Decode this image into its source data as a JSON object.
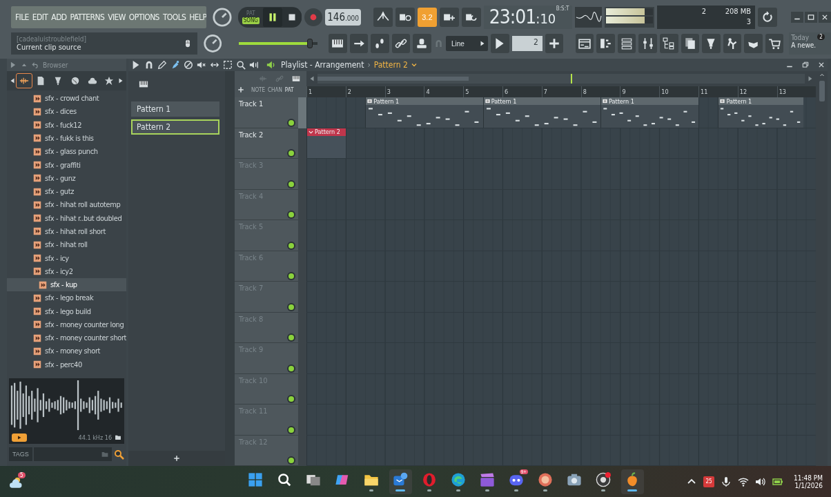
{
  "menu": [
    "FILE",
    "EDIT",
    "ADD",
    "PATTERNS",
    "VIEW",
    "OPTIONS",
    "TOOLS",
    "HELP"
  ],
  "hint": {
    "title": "[cadealuistroublefield]",
    "text": "Current clip source"
  },
  "transport": {
    "modes": [
      {
        "label": "PAT",
        "selected": false
      },
      {
        "label": "SONG",
        "selected": true
      }
    ],
    "playing": true
  },
  "master_volume": {
    "level": 0.9
  },
  "tempo": {
    "whole": "146",
    "fraction": ".000"
  },
  "snap_toggle": {
    "label": "3.2",
    "on": true
  },
  "time": {
    "main": "23:01",
    "sub": ":10",
    "unit": "B:S:T"
  },
  "cpu": {
    "polyphony": "2",
    "memory": "208 MB",
    "cores": "3"
  },
  "snap": {
    "value": "Line"
  },
  "pattern_selector": {
    "value": "2"
  },
  "news": {
    "title": "Today",
    "text": "A newe.",
    "badge": "2"
  },
  "browser": {
    "title": "Browser",
    "tabs": [
      {
        "kind": "waveform",
        "selected": true
      },
      {
        "kind": "file",
        "selected": false
      },
      {
        "kind": "plug",
        "selected": false
      },
      {
        "kind": "globe",
        "selected": false
      },
      {
        "kind": "cloud",
        "selected": false
      },
      {
        "kind": "star",
        "selected": false
      }
    ],
    "items": [
      {
        "label": "sfx - crowd chant",
        "selected": false
      },
      {
        "label": "sfx - dices",
        "selected": false
      },
      {
        "label": "sfx - fuck12",
        "selected": false
      },
      {
        "label": "sfx - fukk is this",
        "selected": false
      },
      {
        "label": "sfx - glass punch",
        "selected": false
      },
      {
        "label": "sfx - graffiti",
        "selected": false
      },
      {
        "label": "sfx - gunz",
        "selected": false
      },
      {
        "label": "sfx - gutz",
        "selected": false
      },
      {
        "label": "sfx - hihat roll autotemp",
        "selected": false
      },
      {
        "label": "sfx - hihat r..but doubled",
        "selected": false
      },
      {
        "label": "sfx - hihat roll short",
        "selected": false
      },
      {
        "label": "sfx - hihat roll",
        "selected": false
      },
      {
        "label": "sfx - icy",
        "selected": false
      },
      {
        "label": "sfx - icy2",
        "selected": false
      },
      {
        "label": "sfx - kup",
        "selected": true
      },
      {
        "label": "sfx - lego break",
        "selected": false
      },
      {
        "label": "sfx - lego build",
        "selected": false
      },
      {
        "label": "sfx - money counter long",
        "selected": false
      },
      {
        "label": "sfx - money counter short",
        "selected": false
      },
      {
        "label": "sfx - money short",
        "selected": false
      },
      {
        "label": "sfx - perc40",
        "selected": false
      }
    ],
    "preview": {
      "info": "44.1 kHz 16"
    },
    "tags": {
      "label": "TAGS"
    }
  },
  "playlist": {
    "title": "Playlist - Arrangement",
    "separator": "›",
    "pattern": "Pattern 2",
    "picker_tabs": [
      {
        "label": "NOTE",
        "selected": false
      },
      {
        "label": "CHAN",
        "selected": false
      },
      {
        "label": "PAT",
        "selected": true
      }
    ],
    "patterns": [
      {
        "label": "Pattern 1",
        "selected": false
      },
      {
        "label": "Pattern 2",
        "selected": true
      }
    ],
    "ruler": [
      "1",
      "2",
      "3",
      "4",
      "5",
      "6",
      "7",
      "8",
      "9",
      "10",
      "11",
      "12",
      "13"
    ],
    "tracks": [
      {
        "name": "Track 1",
        "empty": false,
        "enabled": true,
        "clips": [
          {
            "label": "Pattern 1",
            "kind": "notes",
            "color": "#5e686d"
          },
          {
            "label": "Pattern 1",
            "kind": "notes",
            "color": "#5e686d"
          },
          {
            "label": "Pattern 1",
            "kind": "notes",
            "color": "#5e686d"
          },
          {
            "label": "Pattern 1",
            "kind": "notes",
            "color": "#5e686d"
          }
        ]
      },
      {
        "name": "Track 2",
        "empty": false,
        "enabled": true,
        "clips": [
          {
            "label": "Pattern 2",
            "kind": "blank",
            "color": "#c0364c"
          }
        ]
      },
      {
        "name": "Track 3",
        "empty": true,
        "enabled": true
      },
      {
        "name": "Track 4",
        "empty": true,
        "enabled": true
      },
      {
        "name": "Track 5",
        "empty": true,
        "enabled": true
      },
      {
        "name": "Track 6",
        "empty": true,
        "enabled": true
      },
      {
        "name": "Track 7",
        "empty": true,
        "enabled": true
      },
      {
        "name": "Track 8",
        "empty": true,
        "enabled": true
      },
      {
        "name": "Track 9",
        "empty": true,
        "enabled": true
      },
      {
        "name": "Track 10",
        "empty": true,
        "enabled": true
      },
      {
        "name": "Track 11",
        "empty": true,
        "enabled": true
      },
      {
        "name": "Track 12",
        "empty": true,
        "enabled": true
      }
    ]
  },
  "taskbar": {
    "weather_badge": "5",
    "apps": [
      {
        "kind": "start",
        "running": false,
        "focused": false
      },
      {
        "kind": "search",
        "running": false,
        "focused": false
      },
      {
        "kind": "taskview",
        "running": false,
        "focused": false
      },
      {
        "kind": "copilot",
        "running": false,
        "focused": false
      },
      {
        "kind": "folder",
        "running": true,
        "focused": false
      },
      {
        "kind": "mail",
        "running": true,
        "focused": true
      },
      {
        "kind": "opera",
        "running": true,
        "focused": false
      },
      {
        "kind": "edge",
        "running": true,
        "focused": false
      },
      {
        "kind": "clapper",
        "running": true,
        "focused": false
      },
      {
        "kind": "discord",
        "running": true,
        "focused": false,
        "badge": "9+"
      },
      {
        "kind": "emblem",
        "running": true,
        "focused": false
      },
      {
        "kind": "camera",
        "running": false,
        "focused": false
      },
      {
        "kind": "recorder",
        "running": true,
        "focused": false
      },
      {
        "kind": "fruit",
        "running": true,
        "focused": true
      }
    ],
    "calendar_badge": "25",
    "time": "11:48 PM",
    "date": "1/1/2026"
  }
}
